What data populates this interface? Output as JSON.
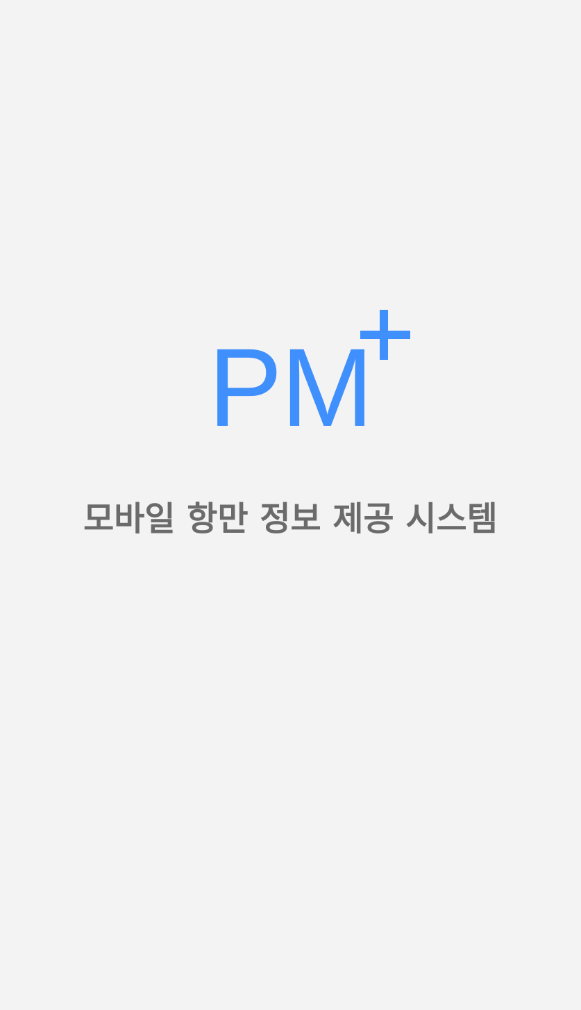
{
  "splash": {
    "logo_text": "PM",
    "logo_superscript": "+",
    "subtitle": "모바일 항만 정보 제공 시스템"
  },
  "colors": {
    "background": "#f3f3f3",
    "brand_blue": "#3f8ffc",
    "subtitle_gray": "#6b6b6b"
  }
}
